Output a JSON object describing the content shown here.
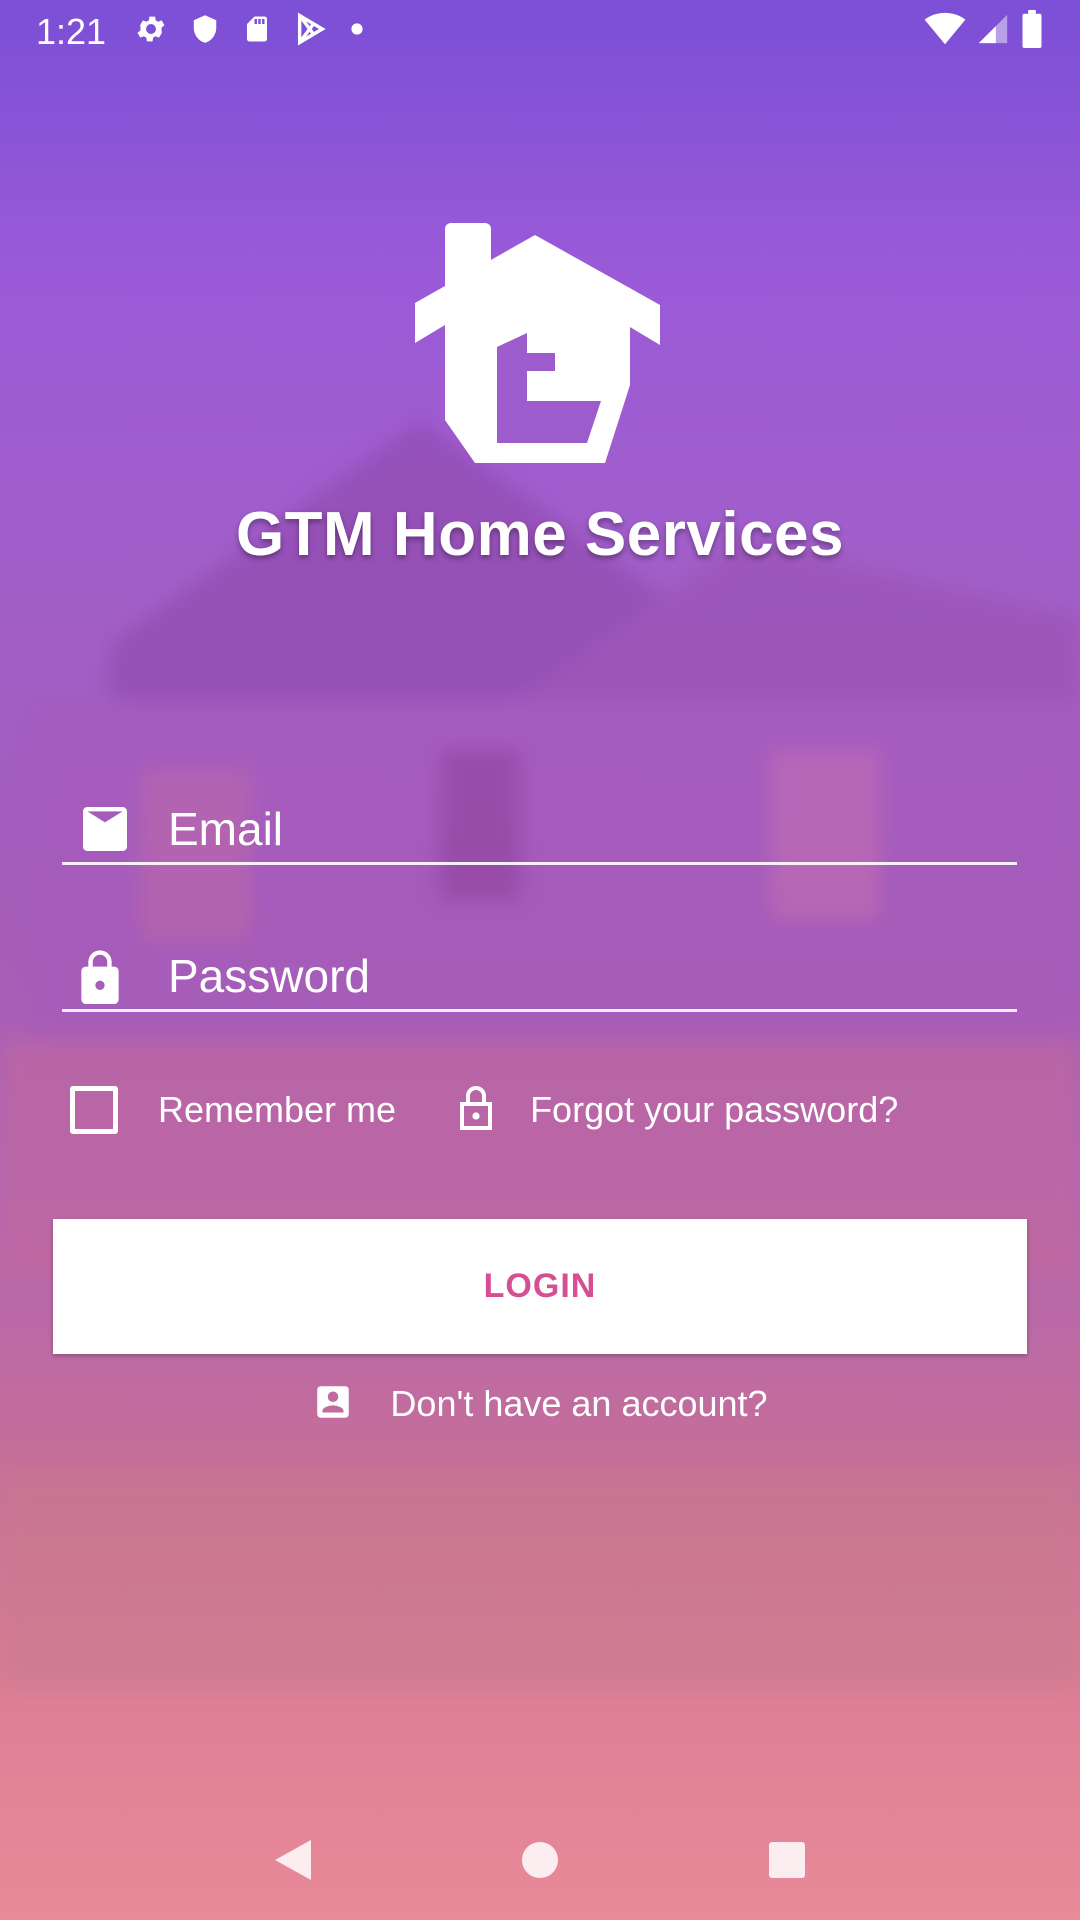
{
  "status_bar": {
    "time": "1:21",
    "icons": [
      "settings-icon",
      "shield-icon",
      "sd-card-icon",
      "play-store-icon",
      "dot-icon"
    ],
    "right_icons": [
      "wifi-icon",
      "signal-icon",
      "battery-icon"
    ]
  },
  "logo": {
    "text": "GTM Home Services"
  },
  "form": {
    "email_placeholder": "Email",
    "email_icon": "email-icon",
    "password_placeholder": "Password",
    "password_icon": "lock-icon",
    "remember_label": "Remember me",
    "remember_checked": false,
    "forgot_label": "Forgot your password?",
    "forgot_icon": "lock-open-icon",
    "login_label": "LOGIN",
    "signup_label": "Don't have an account?",
    "signup_icon": "account-box-icon"
  },
  "colors": {
    "accent": "#d64f95",
    "gradient_top": "#7b4fd6",
    "gradient_bottom": "#e88a98"
  },
  "nav_bar": {
    "buttons": [
      "back-icon",
      "home-icon",
      "recents-icon"
    ]
  }
}
